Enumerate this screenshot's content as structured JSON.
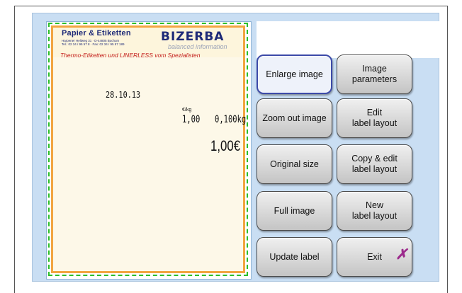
{
  "label": {
    "company": "Papier & Etiketten",
    "address_lines": [
      "Harpener Hellweg 31 · D-44805 Bochum",
      "Tel.: 02 34 / 95 57 8 · Fax: 02 34 / 95 57 189"
    ],
    "brand": "BIZERBA",
    "tagline": "balanced information",
    "slogan": "Thermo-Etiketten und LINERLESS vom Spezialisten",
    "date": "28.10.13",
    "unit": "€/kg",
    "price_per_kg": "1,00",
    "weight": "0,100kg",
    "total": "1,00€"
  },
  "buttons": {
    "enlarge_image": "Enlarge image",
    "image_parameters": "Image\nparameters",
    "zoom_out_image": "Zoom out image",
    "edit_label_layout": "Edit\nlabel layout",
    "original_size": "Original size",
    "copy_edit_label_layout": "Copy & edit\nlabel layout",
    "full_image": "Full image",
    "new_label_layout": "New\nlabel layout",
    "update_label": "Update label",
    "exit": "Exit"
  },
  "icons": {
    "exit": "close-x-icon"
  },
  "colors": {
    "accent": "#3c4aa8",
    "panel": "#c9def3",
    "label_border": "#f2a541",
    "label_dash": "#2bbf2b",
    "exit_icon": "#9c2a8c"
  }
}
